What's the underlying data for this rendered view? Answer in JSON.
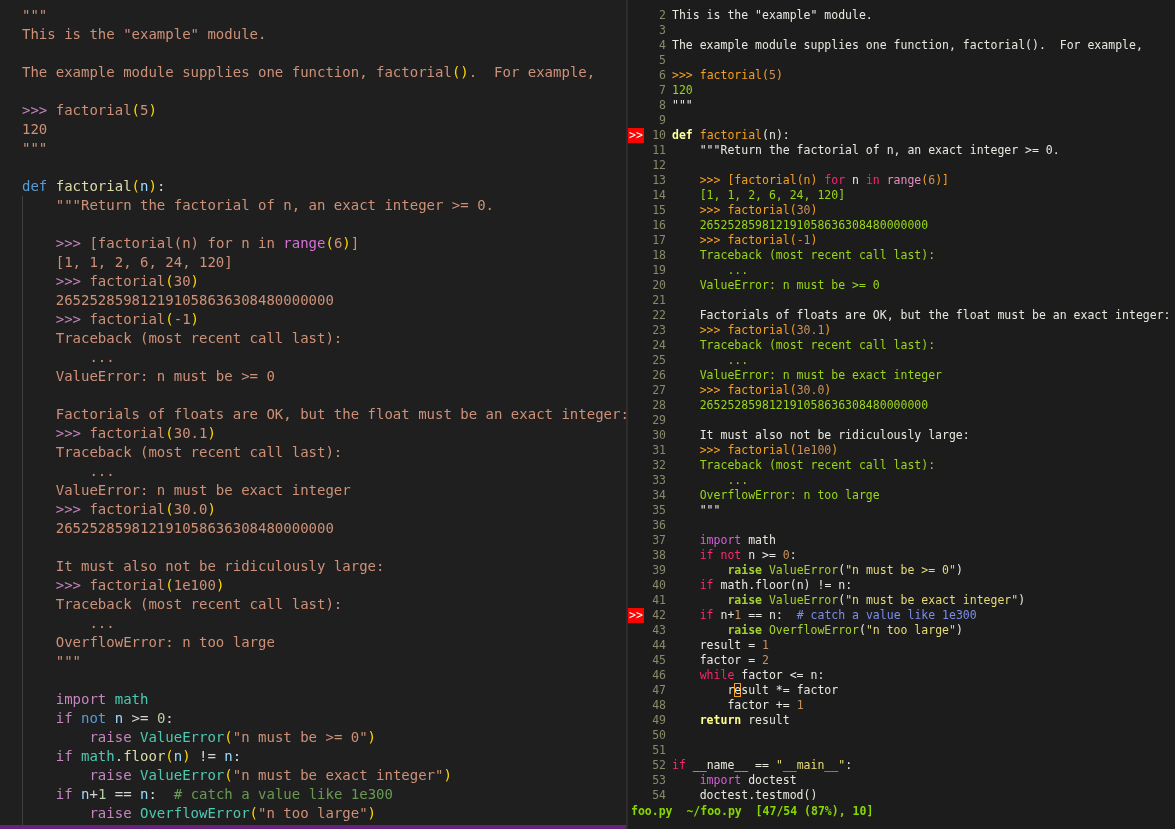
{
  "left_editor": {
    "lines": [
      {
        "kind": "code",
        "tokens": [
          {
            "text": "\"\"\"",
            "kind": "doc"
          }
        ]
      },
      {
        "kind": "code",
        "tokens": [
          {
            "text": "This is the \"example\" module.",
            "kind": "doc"
          }
        ]
      },
      {
        "kind": "blank"
      },
      {
        "kind": "code",
        "tokens": [
          {
            "text": "The example module supplies one function, factorial",
            "kind": "doc"
          },
          {
            "text": "()",
            "kind": "paren"
          },
          {
            "text": ".  For example,",
            "kind": "doc"
          }
        ]
      },
      {
        "kind": "blank"
      },
      {
        "kind": "code",
        "tokens": [
          {
            "text": ">>> ",
            "kind": "prompt"
          },
          {
            "text": "factorial",
            "kind": "call"
          },
          {
            "text": "(",
            "kind": "docparen"
          },
          {
            "text": "5",
            "kind": "docnum"
          },
          {
            "text": ")",
            "kind": "docparen"
          }
        ]
      },
      {
        "kind": "code",
        "tokens": [
          {
            "text": "120",
            "kind": "out"
          }
        ]
      },
      {
        "kind": "code",
        "tokens": [
          {
            "text": "\"\"\"",
            "kind": "doc"
          }
        ]
      },
      {
        "kind": "blank"
      },
      {
        "kind": "code",
        "tokens": [
          {
            "text": "def ",
            "kind": "def"
          },
          {
            "text": "factorial",
            "kind": "fn"
          },
          {
            "text": "(",
            "kind": "paren"
          },
          {
            "text": "n",
            "kind": "param"
          },
          {
            "text": ")",
            "kind": "paren"
          },
          {
            "text": ":",
            "kind": "plain"
          }
        ]
      },
      {
        "kind": "code",
        "tokens": [
          {
            "text": "    \"\"\"Return the factorial of n, an exact integer >= 0.",
            "kind": "doc"
          }
        ]
      },
      {
        "kind": "blank"
      },
      {
        "kind": "code",
        "tokens": [
          {
            "text": "    >>> ",
            "kind": "prompt"
          },
          {
            "text": "[factorial(n) ",
            "kind": "call"
          },
          {
            "text": "for",
            "kind": "dockw"
          },
          {
            "text": " n ",
            "kind": "doc"
          },
          {
            "text": "in",
            "kind": "dockw"
          },
          {
            "text": " range",
            "kind": "docfn"
          },
          {
            "text": "(",
            "kind": "docparen"
          },
          {
            "text": "6",
            "kind": "docnum"
          },
          {
            "text": ")",
            "kind": "docparen"
          },
          {
            "text": "]",
            "kind": "call"
          }
        ]
      },
      {
        "kind": "code",
        "tokens": [
          {
            "text": "    [1, 1, 2, 6, 24, 120]",
            "kind": "out"
          }
        ]
      },
      {
        "kind": "code",
        "tokens": [
          {
            "text": "    >>> ",
            "kind": "prompt"
          },
          {
            "text": "factorial",
            "kind": "call"
          },
          {
            "text": "(",
            "kind": "docparen"
          },
          {
            "text": "30",
            "kind": "docnum"
          },
          {
            "text": ")",
            "kind": "docparen"
          }
        ]
      },
      {
        "kind": "code",
        "tokens": [
          {
            "text": "    265252859812191058636308480000000",
            "kind": "out"
          }
        ]
      },
      {
        "kind": "code",
        "tokens": [
          {
            "text": "    >>> ",
            "kind": "prompt"
          },
          {
            "text": "factorial",
            "kind": "call"
          },
          {
            "text": "(",
            "kind": "docparen"
          },
          {
            "text": "-1",
            "kind": "docnum"
          },
          {
            "text": ")",
            "kind": "docparen"
          }
        ]
      },
      {
        "kind": "code",
        "tokens": [
          {
            "text": "    Traceback (most recent call last):",
            "kind": "out"
          }
        ]
      },
      {
        "kind": "code",
        "tokens": [
          {
            "text": "        ...",
            "kind": "out"
          }
        ]
      },
      {
        "kind": "code",
        "tokens": [
          {
            "text": "    ValueError: n must be >= 0",
            "kind": "out"
          }
        ]
      },
      {
        "kind": "blank"
      },
      {
        "kind": "code",
        "tokens": [
          {
            "text": "    Factorials of floats are OK, but the float must be an exact integer:",
            "kind": "doc"
          }
        ]
      },
      {
        "kind": "code",
        "tokens": [
          {
            "text": "    >>> ",
            "kind": "prompt"
          },
          {
            "text": "factorial",
            "kind": "call"
          },
          {
            "text": "(",
            "kind": "docparen"
          },
          {
            "text": "30.1",
            "kind": "docnum"
          },
          {
            "text": ")",
            "kind": "docparen"
          }
        ]
      },
      {
        "kind": "code",
        "tokens": [
          {
            "text": "    Traceback (most recent call last):",
            "kind": "out"
          }
        ]
      },
      {
        "kind": "code",
        "tokens": [
          {
            "text": "        ...",
            "kind": "out"
          }
        ]
      },
      {
        "kind": "code",
        "tokens": [
          {
            "text": "    ValueError: n must be exact integer",
            "kind": "out"
          }
        ]
      },
      {
        "kind": "code",
        "tokens": [
          {
            "text": "    >>> ",
            "kind": "prompt"
          },
          {
            "text": "factorial",
            "kind": "call"
          },
          {
            "text": "(",
            "kind": "docparen"
          },
          {
            "text": "30.0",
            "kind": "docnum"
          },
          {
            "text": ")",
            "kind": "docparen"
          }
        ]
      },
      {
        "kind": "code",
        "tokens": [
          {
            "text": "    265252859812191058636308480000000",
            "kind": "out"
          }
        ]
      },
      {
        "kind": "blank"
      },
      {
        "kind": "code",
        "tokens": [
          {
            "text": "    It must also not be ridiculously large:",
            "kind": "doc"
          }
        ]
      },
      {
        "kind": "code",
        "tokens": [
          {
            "text": "    >>> ",
            "kind": "prompt"
          },
          {
            "text": "factorial",
            "kind": "call"
          },
          {
            "text": "(",
            "kind": "docparen"
          },
          {
            "text": "1e100",
            "kind": "docnum"
          },
          {
            "text": ")",
            "kind": "docparen"
          }
        ]
      },
      {
        "kind": "code",
        "tokens": [
          {
            "text": "    Traceback (most recent call last):",
            "kind": "out"
          }
        ]
      },
      {
        "kind": "code",
        "tokens": [
          {
            "text": "        ...",
            "kind": "out"
          }
        ]
      },
      {
        "kind": "code",
        "tokens": [
          {
            "text": "    OverflowError: n too large",
            "kind": "out"
          }
        ]
      },
      {
        "kind": "code",
        "tokens": [
          {
            "text": "    \"\"\"",
            "kind": "doc"
          }
        ]
      },
      {
        "kind": "blank"
      },
      {
        "kind": "code",
        "tokens": [
          {
            "text": "    import ",
            "kind": "import"
          },
          {
            "text": "math",
            "kind": "mod"
          }
        ]
      },
      {
        "kind": "code",
        "tokens": [
          {
            "text": "    if ",
            "kind": "ctl"
          },
          {
            "text": "not ",
            "kind": "not"
          },
          {
            "text": "n",
            "kind": "param"
          },
          {
            "text": " >= ",
            "kind": "plain"
          },
          {
            "text": "0",
            "kind": "num"
          },
          {
            "text": ":",
            "kind": "plain"
          }
        ]
      },
      {
        "kind": "code",
        "tokens": [
          {
            "text": "        raise ",
            "kind": "raise"
          },
          {
            "text": "ValueError",
            "kind": "cls"
          },
          {
            "text": "(",
            "kind": "paren"
          },
          {
            "text": "\"n must be >= 0\"",
            "kind": "str"
          },
          {
            "text": ")",
            "kind": "paren"
          }
        ]
      },
      {
        "kind": "code",
        "tokens": [
          {
            "text": "    if ",
            "kind": "ctl"
          },
          {
            "text": "math",
            "kind": "mod"
          },
          {
            "text": ".",
            "kind": "plain"
          },
          {
            "text": "floor",
            "kind": "method"
          },
          {
            "text": "(",
            "kind": "paren"
          },
          {
            "text": "n",
            "kind": "param"
          },
          {
            "text": ")",
            "kind": "paren"
          },
          {
            "text": " != ",
            "kind": "plain"
          },
          {
            "text": "n",
            "kind": "param"
          },
          {
            "text": ":",
            "kind": "plain"
          }
        ]
      },
      {
        "kind": "code",
        "tokens": [
          {
            "text": "        raise ",
            "kind": "raise"
          },
          {
            "text": "ValueError",
            "kind": "cls"
          },
          {
            "text": "(",
            "kind": "paren"
          },
          {
            "text": "\"n must be exact integer\"",
            "kind": "str"
          },
          {
            "text": ")",
            "kind": "paren"
          }
        ]
      },
      {
        "kind": "code",
        "tokens": [
          {
            "text": "    if ",
            "kind": "ctl"
          },
          {
            "text": "n",
            "kind": "param"
          },
          {
            "text": "+",
            "kind": "plain"
          },
          {
            "text": "1",
            "kind": "num"
          },
          {
            "text": " == ",
            "kind": "plain"
          },
          {
            "text": "n",
            "kind": "param"
          },
          {
            "text": ":  ",
            "kind": "plain"
          },
          {
            "text": "# catch a value like 1e300",
            "kind": "cmt"
          }
        ]
      },
      {
        "kind": "code",
        "tokens": [
          {
            "text": "        raise ",
            "kind": "raise"
          },
          {
            "text": "OverflowError",
            "kind": "cls"
          },
          {
            "text": "(",
            "kind": "paren"
          },
          {
            "text": "\"n too large\"",
            "kind": "str"
          },
          {
            "text": ")",
            "kind": "paren"
          }
        ]
      }
    ]
  },
  "right_editor": {
    "lines": [
      {
        "number": "2",
        "tokens": [
          {
            "text": "This is the \"example\" module.",
            "kind": "doc"
          }
        ]
      },
      {
        "number": "3"
      },
      {
        "number": "4",
        "tokens": [
          {
            "text": "The example module supplies one function, factorial",
            "kind": "doc"
          },
          {
            "text": "()",
            "kind": "paren"
          },
          {
            "text": ".  For example,",
            "kind": "doc"
          }
        ]
      },
      {
        "number": "5"
      },
      {
        "number": "6",
        "tokens": [
          {
            "text": ">>> ",
            "kind": "prompt"
          },
          {
            "text": "factorial",
            "kind": "call"
          },
          {
            "text": "(",
            "kind": "docparen"
          },
          {
            "text": "5",
            "kind": "docnum"
          },
          {
            "text": ")",
            "kind": "docparen"
          }
        ]
      },
      {
        "number": "7",
        "tokens": [
          {
            "text": "120",
            "kind": "out"
          }
        ]
      },
      {
        "number": "8",
        "tokens": [
          {
            "text": "\"\"\"",
            "kind": "doc"
          }
        ]
      },
      {
        "number": "9"
      },
      {
        "number": "10",
        "marker": ">>",
        "tokens": [
          {
            "text": "def ",
            "kind": "def"
          },
          {
            "text": "factorial",
            "kind": "fn"
          },
          {
            "text": "(",
            "kind": "paren"
          },
          {
            "text": "n",
            "kind": "param"
          },
          {
            "text": ")",
            "kind": "paren"
          },
          {
            "text": ":",
            "kind": "plain"
          }
        ]
      },
      {
        "number": "11",
        "tokens": [
          {
            "text": "    \"\"\"Return the factorial of n, an exact integer >= 0.",
            "kind": "doc"
          }
        ]
      },
      {
        "number": "12"
      },
      {
        "number": "13",
        "tokens": [
          {
            "text": "    >>> ",
            "kind": "prompt"
          },
          {
            "text": "[factorial(n) ",
            "kind": "call"
          },
          {
            "text": "for",
            "kind": "dockw"
          },
          {
            "text": " n ",
            "kind": "doc"
          },
          {
            "text": "in",
            "kind": "dockw"
          },
          {
            "text": " range",
            "kind": "docfn"
          },
          {
            "text": "(",
            "kind": "docparen"
          },
          {
            "text": "6",
            "kind": "docnum"
          },
          {
            "text": ")",
            "kind": "docparen"
          },
          {
            "text": "]",
            "kind": "call"
          }
        ]
      },
      {
        "number": "14",
        "tokens": [
          {
            "text": "    [1, 1, 2, 6, 24, 120]",
            "kind": "out"
          }
        ]
      },
      {
        "number": "15",
        "tokens": [
          {
            "text": "    >>> ",
            "kind": "prompt"
          },
          {
            "text": "factorial",
            "kind": "call"
          },
          {
            "text": "(",
            "kind": "docparen"
          },
          {
            "text": "30",
            "kind": "docnum"
          },
          {
            "text": ")",
            "kind": "docparen"
          }
        ]
      },
      {
        "number": "16",
        "tokens": [
          {
            "text": "    265252859812191058636308480000000",
            "kind": "out"
          }
        ]
      },
      {
        "number": "17",
        "tokens": [
          {
            "text": "    >>> ",
            "kind": "prompt"
          },
          {
            "text": "factorial",
            "kind": "call"
          },
          {
            "text": "(",
            "kind": "docparen"
          },
          {
            "text": "-1",
            "kind": "docnum"
          },
          {
            "text": ")",
            "kind": "docparen"
          }
        ]
      },
      {
        "number": "18",
        "tokens": [
          {
            "text": "    Traceback (most recent call last):",
            "kind": "out"
          }
        ]
      },
      {
        "number": "19",
        "tokens": [
          {
            "text": "        ...",
            "kind": "out"
          }
        ]
      },
      {
        "number": "20",
        "tokens": [
          {
            "text": "    ValueError: n must be >= 0",
            "kind": "out"
          }
        ]
      },
      {
        "number": "21"
      },
      {
        "number": "22",
        "tokens": [
          {
            "text": "    Factorials of floats are OK, but the float must be an exact integer:",
            "kind": "doc"
          }
        ]
      },
      {
        "number": "23",
        "tokens": [
          {
            "text": "    >>> ",
            "kind": "prompt"
          },
          {
            "text": "factorial",
            "kind": "call"
          },
          {
            "text": "(",
            "kind": "docparen"
          },
          {
            "text": "30.1",
            "kind": "docnum"
          },
          {
            "text": ")",
            "kind": "docparen"
          }
        ]
      },
      {
        "number": "24",
        "tokens": [
          {
            "text": "    Traceback (most recent call last):",
            "kind": "out"
          }
        ]
      },
      {
        "number": "25",
        "tokens": [
          {
            "text": "        ...",
            "kind": "out"
          }
        ]
      },
      {
        "number": "26",
        "tokens": [
          {
            "text": "    ValueError: n must be exact integer",
            "kind": "out"
          }
        ]
      },
      {
        "number": "27",
        "tokens": [
          {
            "text": "    >>> ",
            "kind": "prompt"
          },
          {
            "text": "factorial",
            "kind": "call"
          },
          {
            "text": "(",
            "kind": "docparen"
          },
          {
            "text": "30.0",
            "kind": "docnum"
          },
          {
            "text": ")",
            "kind": "docparen"
          }
        ]
      },
      {
        "number": "28",
        "tokens": [
          {
            "text": "    265252859812191058636308480000000",
            "kind": "out"
          }
        ]
      },
      {
        "number": "29"
      },
      {
        "number": "30",
        "tokens": [
          {
            "text": "    It must also not be ridiculously large:",
            "kind": "doc"
          }
        ]
      },
      {
        "number": "31",
        "tokens": [
          {
            "text": "    >>> ",
            "kind": "prompt"
          },
          {
            "text": "factorial",
            "kind": "call"
          },
          {
            "text": "(",
            "kind": "docparen"
          },
          {
            "text": "1e100",
            "kind": "docnum"
          },
          {
            "text": ")",
            "kind": "docparen"
          }
        ]
      },
      {
        "number": "32",
        "tokens": [
          {
            "text": "    Traceback (most recent call last):",
            "kind": "out"
          }
        ]
      },
      {
        "number": "33",
        "tokens": [
          {
            "text": "        ...",
            "kind": "out"
          }
        ]
      },
      {
        "number": "34",
        "tokens": [
          {
            "text": "    OverflowError: n too large",
            "kind": "out"
          }
        ]
      },
      {
        "number": "35",
        "tokens": [
          {
            "text": "    \"\"\"",
            "kind": "doc"
          }
        ]
      },
      {
        "number": "36"
      },
      {
        "number": "37",
        "tokens": [
          {
            "text": "    import ",
            "kind": "import"
          },
          {
            "text": "math",
            "kind": "mod"
          }
        ]
      },
      {
        "number": "38",
        "tokens": [
          {
            "text": "    if ",
            "kind": "ctl"
          },
          {
            "text": "not ",
            "kind": "not"
          },
          {
            "text": "n",
            "kind": "param"
          },
          {
            "text": " >= ",
            "kind": "plain"
          },
          {
            "text": "0",
            "kind": "num"
          },
          {
            "text": ":",
            "kind": "plain"
          }
        ]
      },
      {
        "number": "39",
        "tokens": [
          {
            "text": "        raise ",
            "kind": "raise"
          },
          {
            "text": "ValueError",
            "kind": "cls"
          },
          {
            "text": "(",
            "kind": "paren"
          },
          {
            "text": "\"n must be >= 0\"",
            "kind": "str"
          },
          {
            "text": ")",
            "kind": "paren"
          }
        ]
      },
      {
        "number": "40",
        "tokens": [
          {
            "text": "    if ",
            "kind": "ctl"
          },
          {
            "text": "math",
            "kind": "mod"
          },
          {
            "text": ".",
            "kind": "plain"
          },
          {
            "text": "floor",
            "kind": "method"
          },
          {
            "text": "(",
            "kind": "paren"
          },
          {
            "text": "n",
            "kind": "param"
          },
          {
            "text": ")",
            "kind": "paren"
          },
          {
            "text": " != ",
            "kind": "plain"
          },
          {
            "text": "n",
            "kind": "param"
          },
          {
            "text": ":",
            "kind": "plain"
          }
        ]
      },
      {
        "number": "41",
        "tokens": [
          {
            "text": "        raise ",
            "kind": "raise"
          },
          {
            "text": "ValueError",
            "kind": "cls"
          },
          {
            "text": "(",
            "kind": "paren"
          },
          {
            "text": "\"n must be exact integer\"",
            "kind": "str"
          },
          {
            "text": ")",
            "kind": "paren"
          }
        ]
      },
      {
        "number": "42",
        "marker": ">>",
        "tokens": [
          {
            "text": "    if ",
            "kind": "ctl"
          },
          {
            "text": "n",
            "kind": "param"
          },
          {
            "text": "+",
            "kind": "plain"
          },
          {
            "text": "1",
            "kind": "num"
          },
          {
            "text": " == ",
            "kind": "plain"
          },
          {
            "text": "n",
            "kind": "param"
          },
          {
            "text": ":  ",
            "kind": "plain"
          },
          {
            "text": "# catch a value like 1e300",
            "kind": "cmt"
          }
        ]
      },
      {
        "number": "43",
        "tokens": [
          {
            "text": "        raise ",
            "kind": "raise"
          },
          {
            "text": "OverflowError",
            "kind": "cls"
          },
          {
            "text": "(",
            "kind": "paren"
          },
          {
            "text": "\"n too large\"",
            "kind": "str"
          },
          {
            "text": ")",
            "kind": "paren"
          }
        ]
      },
      {
        "number": "44",
        "tokens": [
          {
            "text": "    result = ",
            "kind": "plain"
          },
          {
            "text": "1",
            "kind": "num"
          }
        ]
      },
      {
        "number": "45",
        "tokens": [
          {
            "text": "    factor = ",
            "kind": "plain"
          },
          {
            "text": "2",
            "kind": "num"
          }
        ]
      },
      {
        "number": "46",
        "tokens": [
          {
            "text": "    while",
            "kind": "ctl"
          },
          {
            "text": " factor <= n:",
            "kind": "plain"
          }
        ]
      },
      {
        "number": "47",
        "tokens": [
          {
            "text": "        r",
            "kind": "plain"
          },
          {
            "text": "e",
            "kind": "cursor"
          },
          {
            "text": "sult *= factor",
            "kind": "plain"
          }
        ]
      },
      {
        "number": "48",
        "tokens": [
          {
            "text": "        factor += ",
            "kind": "plain"
          },
          {
            "text": "1",
            "kind": "num"
          }
        ]
      },
      {
        "number": "49",
        "tokens": [
          {
            "text": "    return",
            "kind": "return"
          },
          {
            "text": " result",
            "kind": "plain"
          }
        ]
      },
      {
        "number": "50"
      },
      {
        "number": "51"
      },
      {
        "number": "52",
        "tokens": [
          {
            "text": "if",
            "kind": "ctl"
          },
          {
            "text": " __name__ == ",
            "kind": "plain"
          },
          {
            "text": "\"__main__\"",
            "kind": "str"
          },
          {
            "text": ":",
            "kind": "plain"
          }
        ]
      },
      {
        "number": "53",
        "tokens": [
          {
            "text": "    import",
            "kind": "import"
          },
          {
            "text": " doctest",
            "kind": "plain"
          }
        ]
      },
      {
        "number": "54",
        "tokens": [
          {
            "text": "    doctest.testmod()",
            "kind": "plain"
          }
        ]
      }
    ],
    "status_line": "foo.py  ~/foo.py  [47/54 (87%), 10]"
  }
}
